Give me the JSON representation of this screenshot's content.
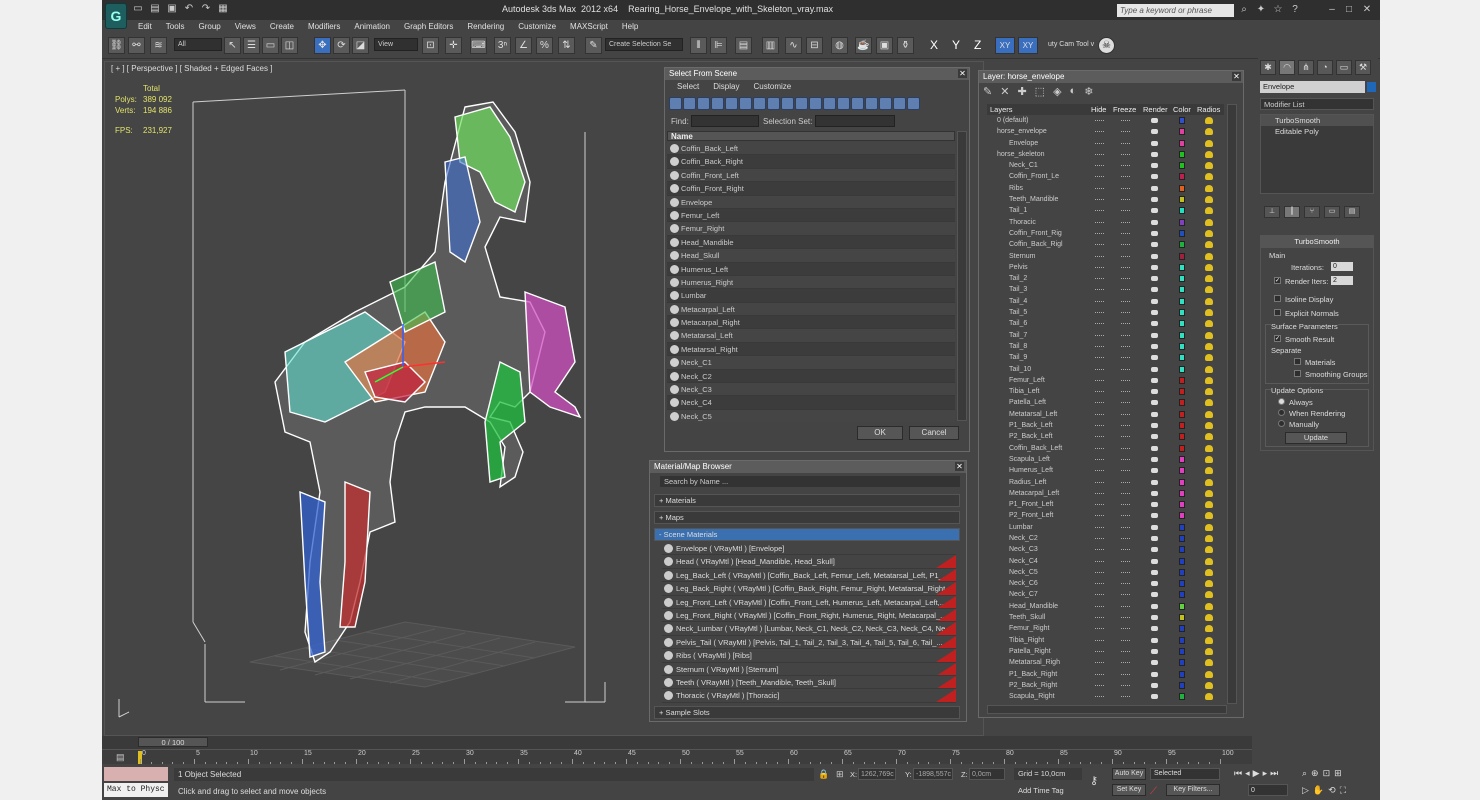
{
  "app": {
    "logo_letter": "G",
    "title": "Autodesk 3ds Max  2012 x64    Rearing_Horse_Envelope_with_Skeleton_vray.max",
    "search_placeholder": "Type a keyword or phrase",
    "menu": [
      "Edit",
      "Tools",
      "Group",
      "Views",
      "Create",
      "Modifiers",
      "Animation",
      "Graph Editors",
      "Rendering",
      "Customize",
      "MAXScript",
      "Help"
    ]
  },
  "toolbar": {
    "filter": "All",
    "refcoord": "View",
    "selection_set": "Create Selection Se",
    "axis_xyz": [
      "X",
      "Y",
      "Z"
    ],
    "axis_planes": [
      "XY",
      "XY"
    ],
    "cam_tool": "uty Cam Tool v"
  },
  "viewport": {
    "label": "[ + ] [ Perspective ] [ Shaded + Edged Faces ]",
    "stats_header": "Total",
    "polys_label": "Polys:",
    "polys_value": "389 092",
    "verts_label": "Verts:",
    "verts_value": "194 886",
    "fps_label": "FPS:",
    "fps_value": "231,927"
  },
  "select_from_scene": {
    "title": "Select From Scene",
    "menu": [
      "Select",
      "Display",
      "Customize"
    ],
    "find_label": "Find:",
    "selection_set_label": "Selection Set:",
    "column_name": "Name",
    "items": [
      "Coffin_Back_Left",
      "Coffin_Back_Right",
      "Coffin_Front_Left",
      "Coffin_Front_Right",
      "Envelope",
      "Femur_Left",
      "Femur_Right",
      "Head_Mandible",
      "Head_Skull",
      "Humerus_Left",
      "Humerus_Right",
      "Lumbar",
      "Metacarpal_Left",
      "Metacarpal_Right",
      "Metatarsal_Left",
      "Metatarsal_Right",
      "Neck_C1",
      "Neck_C2",
      "Neck_C3",
      "Neck_C4",
      "Neck_C5"
    ],
    "ok": "OK",
    "cancel": "Cancel"
  },
  "layer_dialog": {
    "title": "Layer: horse_envelope",
    "columns": [
      "Layers",
      "Hide",
      "Freeze",
      "Render",
      "Color",
      "Radios"
    ],
    "rows": [
      {
        "name": "0 (default)",
        "indent": 0,
        "color": "#3050d0"
      },
      {
        "name": "horse_envelope",
        "indent": 0,
        "color": "#e040a0"
      },
      {
        "name": "Envelope",
        "indent": 1,
        "color": "#e040a0"
      },
      {
        "name": "horse_skeleton",
        "indent": 0,
        "color": "#20c020"
      },
      {
        "name": "Neck_C1",
        "indent": 1,
        "color": "#20c020"
      },
      {
        "name": "Coffin_Front_Le",
        "indent": 1,
        "color": "#c02050"
      },
      {
        "name": "Ribs",
        "indent": 1,
        "color": "#e06020"
      },
      {
        "name": "Teeth_Mandible",
        "indent": 1,
        "color": "#c0c020"
      },
      {
        "name": "Tail_1",
        "indent": 1,
        "color": "#20e0c0"
      },
      {
        "name": "Thoracic",
        "indent": 1,
        "color": "#8040c0"
      },
      {
        "name": "Coffin_Front_Rig",
        "indent": 1,
        "color": "#2050c0"
      },
      {
        "name": "Coffin_Back_Rigl",
        "indent": 1,
        "color": "#20b040"
      },
      {
        "name": "Sternum",
        "indent": 1,
        "color": "#a02040"
      },
      {
        "name": "Pelvis",
        "indent": 1,
        "color": "#30e0c0"
      },
      {
        "name": "Tail_2",
        "indent": 1,
        "color": "#30e0c0"
      },
      {
        "name": "Tail_3",
        "indent": 1,
        "color": "#30e0c0"
      },
      {
        "name": "Tail_4",
        "indent": 1,
        "color": "#30e0c0"
      },
      {
        "name": "Tail_5",
        "indent": 1,
        "color": "#30e0c0"
      },
      {
        "name": "Tail_6",
        "indent": 1,
        "color": "#30e0c0"
      },
      {
        "name": "Tail_7",
        "indent": 1,
        "color": "#30e0c0"
      },
      {
        "name": "Tail_8",
        "indent": 1,
        "color": "#30e0c0"
      },
      {
        "name": "Tail_9",
        "indent": 1,
        "color": "#30e0c0"
      },
      {
        "name": "Tail_10",
        "indent": 1,
        "color": "#30e0c0"
      },
      {
        "name": "Femur_Left",
        "indent": 1,
        "color": "#c02020"
      },
      {
        "name": "Tibia_Left",
        "indent": 1,
        "color": "#c02020"
      },
      {
        "name": "Patella_Left",
        "indent": 1,
        "color": "#c02020"
      },
      {
        "name": "Metatarsal_Left",
        "indent": 1,
        "color": "#c02020"
      },
      {
        "name": "P1_Back_Left",
        "indent": 1,
        "color": "#c02020"
      },
      {
        "name": "P2_Back_Left",
        "indent": 1,
        "color": "#c02020"
      },
      {
        "name": "Coffin_Back_Left",
        "indent": 1,
        "color": "#c02020"
      },
      {
        "name": "Scapula_Left",
        "indent": 1,
        "color": "#e040c0"
      },
      {
        "name": "Humerus_Left",
        "indent": 1,
        "color": "#e040c0"
      },
      {
        "name": "Radius_Left",
        "indent": 1,
        "color": "#e040c0"
      },
      {
        "name": "Metacarpal_Left",
        "indent": 1,
        "color": "#e040c0"
      },
      {
        "name": "P1_Front_Left",
        "indent": 1,
        "color": "#e040c0"
      },
      {
        "name": "P2_Front_Left",
        "indent": 1,
        "color": "#e040c0"
      },
      {
        "name": "Lumbar",
        "indent": 1,
        "color": "#2040c0"
      },
      {
        "name": "Neck_C2",
        "indent": 1,
        "color": "#2040c0"
      },
      {
        "name": "Neck_C3",
        "indent": 1,
        "color": "#2040c0"
      },
      {
        "name": "Neck_C4",
        "indent": 1,
        "color": "#2040c0"
      },
      {
        "name": "Neck_C5",
        "indent": 1,
        "color": "#2040c0"
      },
      {
        "name": "Neck_C6",
        "indent": 1,
        "color": "#2040c0"
      },
      {
        "name": "Neck_C7",
        "indent": 1,
        "color": "#2040c0"
      },
      {
        "name": "Head_Mandible",
        "indent": 1,
        "color": "#60d040"
      },
      {
        "name": "Teeth_Skull",
        "indent": 1,
        "color": "#c0c020"
      },
      {
        "name": "Femur_Right",
        "indent": 1,
        "color": "#2040c0"
      },
      {
        "name": "Tibia_Right",
        "indent": 1,
        "color": "#2040c0"
      },
      {
        "name": "Patella_Right",
        "indent": 1,
        "color": "#2040c0"
      },
      {
        "name": "Metatarsal_Righ",
        "indent": 1,
        "color": "#2040c0"
      },
      {
        "name": "P1_Back_Right",
        "indent": 1,
        "color": "#2040c0"
      },
      {
        "name": "P2_Back_Right",
        "indent": 1,
        "color": "#2040c0"
      },
      {
        "name": "Scapula_Right",
        "indent": 1,
        "color": "#20b040"
      }
    ]
  },
  "material_browser": {
    "title": "Material/Map Browser",
    "search": "Search by Name ...",
    "groups": [
      "+ Materials",
      "+ Maps",
      "- Scene Materials",
      "+ Sample Slots"
    ],
    "materials": [
      "Envelope  ( VRayMtl )  [Envelope]",
      "Head  ( VRayMtl )  [Head_Mandible, Head_Skull]",
      "Leg_Back_Left  ( VRayMtl )  [Coffin_Back_Left, Femur_Left, Metatarsal_Left, P1_...",
      "Leg_Back_Right  ( VRayMtl )  [Coffin_Back_Right, Femur_Right, Metatarsal_Right...",
      "Leg_Front_Left  ( VRayMtl )  [Coffin_Front_Left, Humerus_Left, Metacarpal_Left,...",
      "Leg_Front_Right  ( VRayMtl )  [Coffin_Front_Right, Humerus_Right, Metacarpal_...",
      "Neck_Lumbar  ( VRayMtl )  [Lumbar, Neck_C1, Neck_C2, Neck_C3, Neck_C4, Ne...",
      "Pelvis_Tail  ( VRayMtl )  [Pelvis, Tail_1, Tail_2, Tail_3, Tail_4, Tail_5, Tail_6, Tail_...",
      "Ribs  ( VRayMtl )  [Ribs]",
      "Sternum  ( VRayMtl )  [Sternum]",
      "Teeth  ( VRayMtl )  [Teeth_Mandible, Teeth_Skull]",
      "Thoracic  ( VRayMtl )  [Thoracic]"
    ]
  },
  "command_panel": {
    "object_name": "Envelope",
    "modifier_list": "Modifier List",
    "stack": [
      "TurboSmooth",
      "Editable Poly"
    ],
    "rollout_title": "TurboSmooth",
    "main_label": "Main",
    "iterations_label": "Iterations:",
    "iterations_value": "0",
    "render_iters_label": "Render Iters:",
    "render_iters_value": "2",
    "isoline_label": "Isoline Display",
    "explicit_label": "Explicit Normals",
    "surface_label": "Surface Parameters",
    "smooth_label": "Smooth Result",
    "separate_label": "Separate",
    "materials_label": "Materials",
    "smoothing_label": "Smoothing Groups",
    "update_label": "Update Options",
    "always_label": "Always",
    "when_render_label": "When Rendering",
    "manually_label": "Manually",
    "update_button": "Update"
  },
  "timeline": {
    "frame": "0 / 100",
    "ticks": [
      "0",
      "5",
      "10",
      "15",
      "20",
      "25",
      "30",
      "35",
      "40",
      "45",
      "50",
      "55",
      "60",
      "65",
      "70",
      "75",
      "80",
      "85",
      "90",
      "95",
      "100"
    ]
  },
  "status": {
    "maxscript_label": "Max to Physc",
    "objects_selected": "1 Object Selected",
    "prompt": "Click and drag to select and move objects",
    "x_label": "X:",
    "x_value": "1262,769c",
    "y_label": "Y:",
    "y_value": "-1898,557c",
    "z_label": "Z:",
    "z_value": "0,0cm",
    "grid": "Grid = 10,0cm",
    "add_time_tag": "Add Time Tag",
    "auto_key": "Auto Key",
    "set_key": "Set Key",
    "selected": "Selected",
    "key_filters": "Key Filters...",
    "frame_field": "0"
  }
}
